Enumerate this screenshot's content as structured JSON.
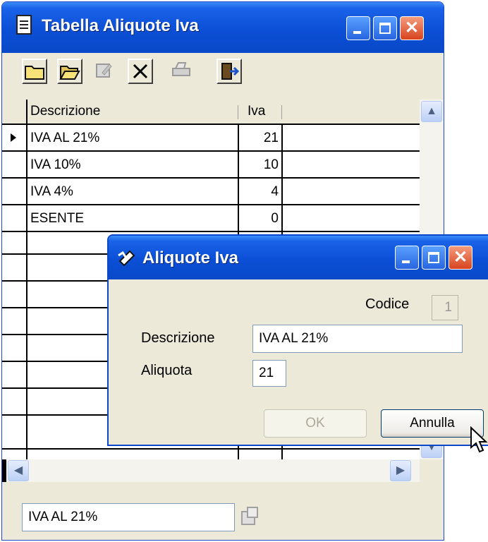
{
  "main_window": {
    "title": "Tabella Aliquote Iva"
  },
  "grid": {
    "columns": [
      "Descrizione",
      "Iva"
    ],
    "rows": [
      {
        "descrizione": "IVA AL 21%",
        "iva": "21"
      },
      {
        "descrizione": "IVA 10%",
        "iva": "10"
      },
      {
        "descrizione": "IVA 4%",
        "iva": "4"
      },
      {
        "descrizione": "ESENTE",
        "iva": "0"
      }
    ]
  },
  "status_field": {
    "value": "IVA AL 21%"
  },
  "dialog": {
    "title": "Aliquote Iva",
    "codice_label": "Codice",
    "codice_value": "1",
    "descrizione_label": "Descrizione",
    "descrizione_value": "IVA AL 21%",
    "aliquota_label": "Aliquota",
    "aliquota_value": "21",
    "ok_label": "OK",
    "annulla_label": "Annulla"
  },
  "icons": {
    "toolbar": [
      "new-folder-icon",
      "open-folder-icon",
      "edit-icon",
      "delete-icon",
      "print-icon",
      "exit-icon"
    ]
  }
}
